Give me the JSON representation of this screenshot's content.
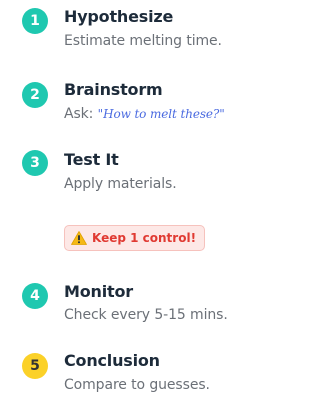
{
  "steps": [
    {
      "number": "1",
      "title": "Hypothesize",
      "description": "Estimate melting time.",
      "badge_color": "#1fc8b0"
    },
    {
      "number": "2",
      "title": "Brainstorm",
      "description_prefix": "Ask: ",
      "quote": "\"How to melt these?\"",
      "badge_color": "#1fc8b0"
    },
    {
      "number": "3",
      "title": "Test It",
      "description": "Apply materials.",
      "badge_color": "#1fc8b0"
    },
    {
      "number": "4",
      "title": "Monitor",
      "description": "Check every 5-15 mins.",
      "badge_color": "#1fc8b0"
    },
    {
      "number": "5",
      "title": "Conclusion",
      "description": "Compare to guesses.",
      "badge_color": "#fbd128"
    }
  ],
  "callout": {
    "icon": "warning-icon",
    "text": "Keep 1 control!",
    "text_color": "#e03a32",
    "background": "#fde8e6"
  }
}
